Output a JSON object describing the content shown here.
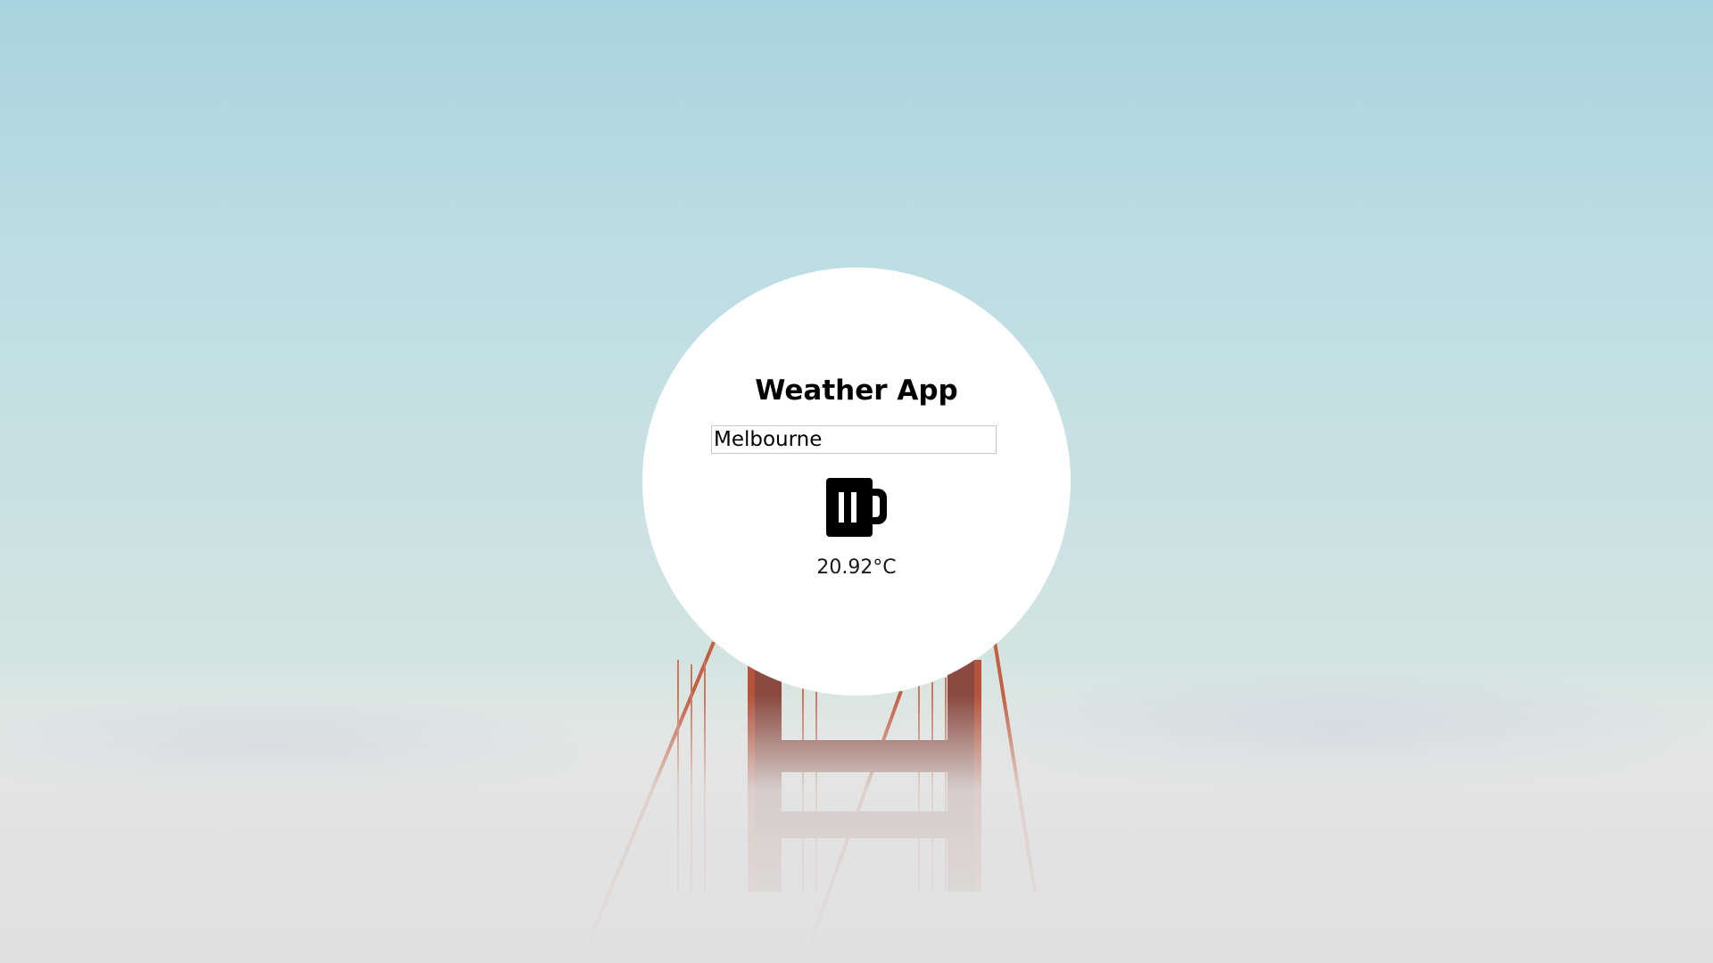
{
  "app": {
    "title": "Weather App"
  },
  "search": {
    "value": "Melbourne"
  },
  "weather": {
    "icon": "beer-mug-icon",
    "temperature": "20.92°C"
  },
  "colors": {
    "card": "#ffffff",
    "bridge": "#b5533c",
    "sky_top": "#a9d3e0",
    "fog": "#e1e1e1"
  }
}
